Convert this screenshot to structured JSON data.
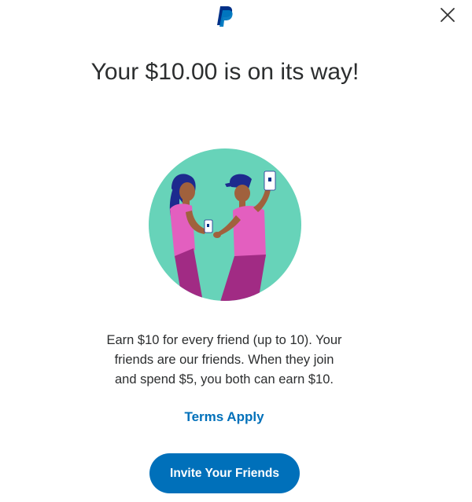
{
  "header": {
    "logo_icon": "paypal-logo-icon",
    "close_icon": "close-icon"
  },
  "main": {
    "title": "Your $10.00 is on its way!",
    "illustration_icon": "friends-exchanging-phones-illustration",
    "description": "Earn $10 for every friend (up to 10). Your friends are our friends. When they join and spend $5, you both can earn $10.",
    "terms_link": "Terms Apply",
    "invite_button": "Invite Your Friends"
  },
  "colors": {
    "brand_blue": "#0070ba",
    "dark_blue": "#003087",
    "illustration_bg": "#67d3b9",
    "shirt_pink": "#e35fbf",
    "pants_magenta": "#a12b84",
    "text": "#2c2e2f"
  }
}
